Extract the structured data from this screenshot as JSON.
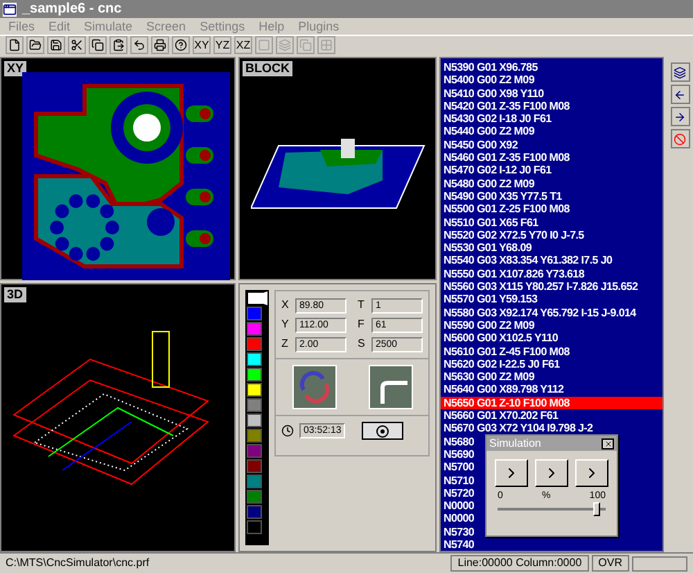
{
  "window": {
    "title": "_sample6 - cnc"
  },
  "menu": [
    "Files",
    "Edit",
    "Simulate",
    "Screen",
    "Settings",
    "Help",
    "Plugins"
  ],
  "toolbar": [
    {
      "kind": "icon",
      "disabled": false
    },
    {
      "kind": "icon",
      "disabled": false
    },
    {
      "kind": "icon",
      "disabled": false
    },
    {
      "kind": "icon",
      "disabled": false
    },
    {
      "kind": "icon",
      "disabled": false
    },
    {
      "kind": "icon",
      "disabled": false
    },
    {
      "kind": "icon",
      "disabled": false
    },
    {
      "kind": "icon",
      "disabled": false
    },
    {
      "kind": "icon",
      "disabled": false
    },
    {
      "kind": "text",
      "label": "XY",
      "disabled": false
    },
    {
      "kind": "text",
      "label": "YZ",
      "disabled": false
    },
    {
      "kind": "text",
      "label": "XZ",
      "disabled": false
    },
    {
      "kind": "icon",
      "disabled": true
    },
    {
      "kind": "icon",
      "disabled": true
    },
    {
      "kind": "icon",
      "disabled": true
    },
    {
      "kind": "icon",
      "disabled": true
    }
  ],
  "views": {
    "xy": "XY",
    "block": "BLOCK",
    "three_d": "3D"
  },
  "palette": [
    {
      "color": "#ffffff",
      "selected": true
    },
    {
      "color": "#0000ff",
      "selected": false
    },
    {
      "color": "#ff00ff",
      "selected": false
    },
    {
      "color": "#ff0000",
      "selected": false
    },
    {
      "color": "#00ffff",
      "selected": false
    },
    {
      "color": "#00ff00",
      "selected": false
    },
    {
      "color": "#ffff00",
      "selected": false
    },
    {
      "color": "#808080",
      "selected": false
    },
    {
      "color": "#c0c0c0",
      "selected": false
    },
    {
      "color": "#808000",
      "selected": false
    },
    {
      "color": "#800080",
      "selected": false
    },
    {
      "color": "#800000",
      "selected": false
    },
    {
      "color": "#008080",
      "selected": false
    },
    {
      "color": "#008000",
      "selected": false
    },
    {
      "color": "#000080",
      "selected": false
    },
    {
      "color": "#000000",
      "selected": false
    }
  ],
  "coordinates": [
    {
      "label": "X",
      "value": "89.80"
    },
    {
      "label": "T",
      "value": "1"
    },
    {
      "label": "Y",
      "value": "112.00"
    },
    {
      "label": "F",
      "value": "61"
    },
    {
      "label": "Z",
      "value": "2.00"
    },
    {
      "label": "S",
      "value": "2500"
    }
  ],
  "elapsed_time": "03:52:13",
  "code": [
    {
      "text": "N5390 G01 X96.785",
      "selected": false
    },
    {
      "text": "N5400 G00 Z2 M09",
      "selected": false
    },
    {
      "text": "N5410 G00 X98 Y110",
      "selected": false
    },
    {
      "text": "N5420 G01 Z-35 F100 M08",
      "selected": false
    },
    {
      "text": "N5430 G02 I-18 J0 F61",
      "selected": false
    },
    {
      "text": "N5440 G00 Z2 M09",
      "selected": false
    },
    {
      "text": "N5450 G00 X92",
      "selected": false
    },
    {
      "text": "N5460 G01 Z-35 F100 M08",
      "selected": false
    },
    {
      "text": "N5470 G02 I-12 J0 F61",
      "selected": false
    },
    {
      "text": "N5480 G00 Z2 M09",
      "selected": false
    },
    {
      "text": "N5490 G00 X35 Y77.5 T1",
      "selected": false
    },
    {
      "text": "N5500 G01 Z-25 F100 M08",
      "selected": false
    },
    {
      "text": "N5510 G01 X65 F61",
      "selected": false
    },
    {
      "text": "N5520 G02 X72.5 Y70 I0 J-7.5",
      "selected": false
    },
    {
      "text": "N5530 G01 Y68.09",
      "selected": false
    },
    {
      "text": "N5540 G03 X83.354 Y61.382 I7.5 J0",
      "selected": false
    },
    {
      "text": "N5550 G01 X107.826 Y73.618",
      "selected": false
    },
    {
      "text": "N5560 G03 X115 Y80.257 I-7.826 J15.652",
      "selected": false
    },
    {
      "text": "N5570 G01 Y59.153",
      "selected": false
    },
    {
      "text": "N5580 G03 X92.174 Y65.792 I-15 J-9.014",
      "selected": false
    },
    {
      "text": "N5590 G00 Z2 M09",
      "selected": false
    },
    {
      "text": "N5600 G00 X102.5 Y110",
      "selected": false
    },
    {
      "text": "N5610 G01 Z-45 F100 M08",
      "selected": false
    },
    {
      "text": "N5620 G02 I-22.5 J0 F61",
      "selected": false
    },
    {
      "text": "N5630 G00 Z2 M09",
      "selected": false
    },
    {
      "text": "N5640 G00 X89.798 Y112",
      "selected": false
    },
    {
      "text": "N5650 G01 Z-10 F100 M08",
      "selected": true
    },
    {
      "text": "N5660 G01 X70.202 F61",
      "selected": false
    },
    {
      "text": "N5670 G03 X72 Y104 I9.798 J-2",
      "selected": false
    },
    {
      "text": "N5680",
      "selected": false
    },
    {
      "text": "N5690",
      "selected": false
    },
    {
      "text": "N5700",
      "selected": false
    },
    {
      "text": "N5710",
      "selected": false
    },
    {
      "text": "N5720",
      "selected": false
    },
    {
      "text": "N0000",
      "selected": false
    },
    {
      "text": "N0000",
      "selected": false
    },
    {
      "text": "N5730",
      "selected": false
    },
    {
      "text": "N5740",
      "selected": false
    }
  ],
  "simulation_dialog": {
    "title": "Simulation",
    "slider_min": "0",
    "slider_unit": "%",
    "slider_max": "100",
    "level": 0.95
  },
  "status_bar": {
    "path": "C:\\MTS\\CncSimulator\\cnc.prf",
    "position": "Line:00000 Column:0000",
    "mode": "OVR"
  }
}
